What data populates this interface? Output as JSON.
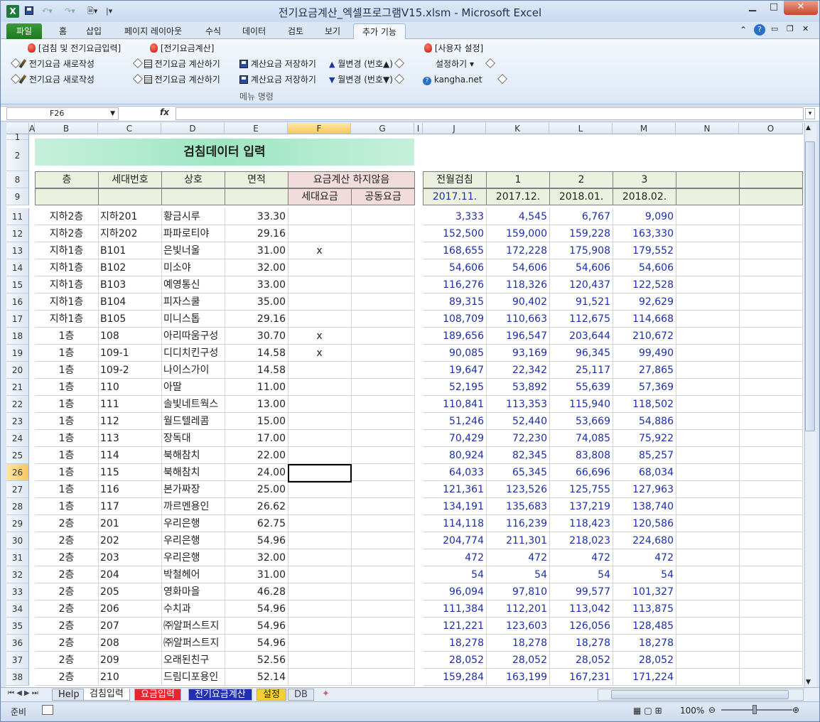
{
  "window": {
    "title": "전기요금계산_엑셀프로그램V15.xlsm - Microsoft Excel"
  },
  "tabs": [
    "홈",
    "삽입",
    "페이지 레이아웃",
    "수식",
    "데이터",
    "검토",
    "보기",
    "추가 기능"
  ],
  "file_tab": "파일",
  "ribbon": {
    "g1_head": "[검침 및 전기요금입력]",
    "g1_b1": "전기요금 새로작성",
    "g1_b2": "전기요금 새로작성",
    "g2_head": "[전기요금계산]",
    "g2_b1": "전기요금 계산하기",
    "g2_b2": "전기요금 계산하기",
    "g3_b1": "계산요금 저장하기",
    "g3_b2": "계산요금 저장하기",
    "g4_b1": "월변경 (번호▲)",
    "g4_b2": "월변경 (번호▼)",
    "g5_head": "[사용자 설정]",
    "g5_b1": "설정하기 ▾",
    "g5_b2": "kangha.net",
    "group_label": "메뉴 명령"
  },
  "formula": {
    "namebox": "F26",
    "fx": "fx",
    "value": ""
  },
  "columns": [
    "A",
    "B",
    "C",
    "D",
    "E",
    "F",
    "G",
    "I",
    "J",
    "K",
    "L",
    "M",
    "N",
    "O"
  ],
  "sheet": {
    "banner": "검침데이터 입력",
    "h_floor": "층",
    "h_unit": "세대번호",
    "h_name": "상호",
    "h_area": "면적",
    "h_nocalc": "요금계산 하지않음",
    "h_house": "세대요금",
    "h_common": "공동요금",
    "h_prev": "전월검침",
    "h_m1": "1",
    "h_m2": "2",
    "h_m3": "3",
    "d_prev": "2017.11.",
    "d_m1": "2017.12.",
    "d_m2": "2018.01.",
    "d_m3": "2018.02.",
    "rows": [
      {
        "r": "11",
        "floor": "지하2층",
        "unit": "지하201",
        "name": "황금시루",
        "area": "33.30",
        "f": "",
        "j": "3,333",
        "k": "4,545",
        "l": "6,767",
        "m": "9,090"
      },
      {
        "r": "12",
        "floor": "지하2층",
        "unit": "지하202",
        "name": "파파로티야",
        "area": "29.16",
        "f": "",
        "j": "152,500",
        "k": "159,000",
        "l": "159,228",
        "m": "163,330"
      },
      {
        "r": "13",
        "floor": "지하1층",
        "unit": "B101",
        "name": "은빛너울",
        "area": "31.00",
        "f": "x",
        "j": "168,655",
        "k": "172,228",
        "l": "175,908",
        "m": "179,552"
      },
      {
        "r": "14",
        "floor": "지하1층",
        "unit": "B102",
        "name": "미소야",
        "area": "32.00",
        "f": "",
        "j": "54,606",
        "k": "54,606",
        "l": "54,606",
        "m": "54,606"
      },
      {
        "r": "15",
        "floor": "지하1층",
        "unit": "B103",
        "name": "예영통신",
        "area": "33.00",
        "f": "",
        "j": "116,276",
        "k": "118,326",
        "l": "120,437",
        "m": "122,528"
      },
      {
        "r": "16",
        "floor": "지하1층",
        "unit": "B104",
        "name": "피자스쿨",
        "area": "35.00",
        "f": "",
        "j": "89,315",
        "k": "90,402",
        "l": "91,521",
        "m": "92,629"
      },
      {
        "r": "17",
        "floor": "지하1층",
        "unit": "B105",
        "name": "미니스톱",
        "area": "29.16",
        "f": "",
        "j": "108,709",
        "k": "110,663",
        "l": "112,675",
        "m": "114,668"
      },
      {
        "r": "18",
        "floor": "1층",
        "unit": "108",
        "name": "아리따움구성",
        "area": "30.70",
        "f": "x",
        "j": "189,656",
        "k": "196,547",
        "l": "203,644",
        "m": "210,672"
      },
      {
        "r": "19",
        "floor": "1층",
        "unit": "109-1",
        "name": "디디치킨구성",
        "area": "14.58",
        "f": "x",
        "j": "90,085",
        "k": "93,169",
        "l": "96,345",
        "m": "99,490"
      },
      {
        "r": "20",
        "floor": "1층",
        "unit": "109-2",
        "name": "나이스가이",
        "area": "14.58",
        "f": "",
        "j": "19,647",
        "k": "22,342",
        "l": "25,117",
        "m": "27,865"
      },
      {
        "r": "21",
        "floor": "1층",
        "unit": "110",
        "name": "아딸",
        "area": "11.00",
        "f": "",
        "j": "52,195",
        "k": "53,892",
        "l": "55,639",
        "m": "57,369"
      },
      {
        "r": "22",
        "floor": "1층",
        "unit": "111",
        "name": "솔빛네트웍스",
        "area": "13.00",
        "f": "",
        "j": "110,841",
        "k": "113,353",
        "l": "115,940",
        "m": "118,502"
      },
      {
        "r": "23",
        "floor": "1층",
        "unit": "112",
        "name": "월드텔레콤",
        "area": "15.00",
        "f": "",
        "j": "51,246",
        "k": "52,440",
        "l": "53,669",
        "m": "54,886"
      },
      {
        "r": "24",
        "floor": "1층",
        "unit": "113",
        "name": "장독대",
        "area": "17.00",
        "f": "",
        "j": "70,429",
        "k": "72,230",
        "l": "74,085",
        "m": "75,922"
      },
      {
        "r": "25",
        "floor": "1층",
        "unit": "114",
        "name": "북해참치",
        "area": "22.00",
        "f": "",
        "j": "80,924",
        "k": "82,345",
        "l": "83,808",
        "m": "85,257"
      },
      {
        "r": "26",
        "floor": "1층",
        "unit": "115",
        "name": "북해참치",
        "area": "24.00",
        "f": "",
        "j": "64,033",
        "k": "65,345",
        "l": "66,696",
        "m": "68,034"
      },
      {
        "r": "27",
        "floor": "1층",
        "unit": "116",
        "name": "본가짜장",
        "area": "25.00",
        "f": "",
        "j": "121,361",
        "k": "123,526",
        "l": "125,755",
        "m": "127,963"
      },
      {
        "r": "28",
        "floor": "1층",
        "unit": "117",
        "name": "까르멘용인",
        "area": "26.62",
        "f": "",
        "j": "134,191",
        "k": "135,683",
        "l": "137,219",
        "m": "138,740"
      },
      {
        "r": "29",
        "floor": "2층",
        "unit": "201",
        "name": "우리은행",
        "area": "62.75",
        "f": "",
        "j": "114,118",
        "k": "116,239",
        "l": "118,423",
        "m": "120,586"
      },
      {
        "r": "30",
        "floor": "2층",
        "unit": "202",
        "name": "우리은행",
        "area": "54.96",
        "f": "",
        "j": "204,774",
        "k": "211,301",
        "l": "218,023",
        "m": "224,680"
      },
      {
        "r": "31",
        "floor": "2층",
        "unit": "203",
        "name": "우리은행",
        "area": "32.00",
        "f": "",
        "j": "472",
        "k": "472",
        "l": "472",
        "m": "472"
      },
      {
        "r": "32",
        "floor": "2층",
        "unit": "204",
        "name": "박철헤어",
        "area": "31.00",
        "f": "",
        "j": "54",
        "k": "54",
        "l": "54",
        "m": "54"
      },
      {
        "r": "33",
        "floor": "2층",
        "unit": "205",
        "name": "영화마을",
        "area": "46.28",
        "f": "",
        "j": "96,094",
        "k": "97,810",
        "l": "99,577",
        "m": "101,327"
      },
      {
        "r": "34",
        "floor": "2층",
        "unit": "206",
        "name": "수치과",
        "area": "54.96",
        "f": "",
        "j": "111,384",
        "k": "112,201",
        "l": "113,042",
        "m": "113,875"
      },
      {
        "r": "35",
        "floor": "2층",
        "unit": "207",
        "name": "㈜알퍼스트지",
        "area": "54.96",
        "f": "",
        "j": "121,221",
        "k": "123,603",
        "l": "126,056",
        "m": "128,485"
      },
      {
        "r": "36",
        "floor": "2층",
        "unit": "208",
        "name": "㈜알퍼스트지",
        "area": "54.96",
        "f": "",
        "j": "18,278",
        "k": "18,278",
        "l": "18,278",
        "m": "18,278"
      },
      {
        "r": "37",
        "floor": "2층",
        "unit": "209",
        "name": "오래된친구",
        "area": "52.56",
        "f": "",
        "j": "28,052",
        "k": "28,052",
        "l": "28,052",
        "m": "28,052"
      },
      {
        "r": "38",
        "floor": "2층",
        "unit": "210",
        "name": "드림디포용인",
        "area": "52.14",
        "f": "",
        "j": "159,284",
        "k": "163,199",
        "l": "167,231",
        "m": "171,224"
      }
    ]
  },
  "sheet_tabs": [
    "Help",
    "검침입력",
    "요금입력",
    "전기요금계산",
    "설정",
    "DB"
  ],
  "status": {
    "ready": "준비",
    "zoom": "100%"
  }
}
